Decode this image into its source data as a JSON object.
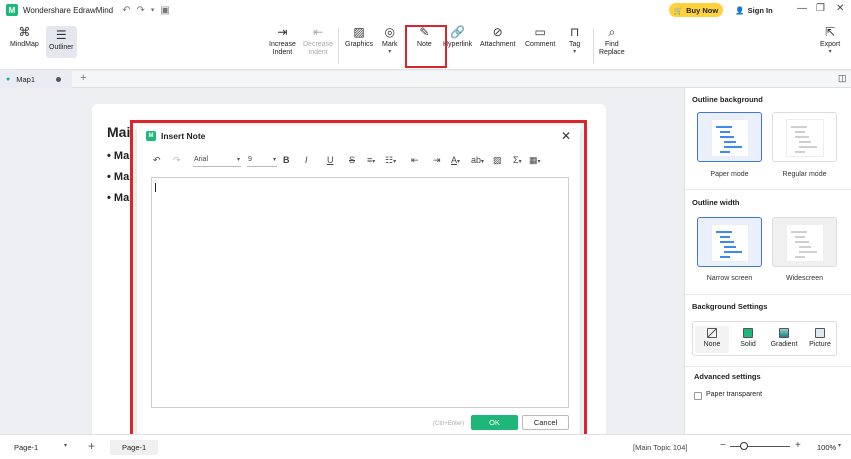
{
  "app": {
    "title": "Wondershare EdrawMind",
    "buy_now": "Buy Now",
    "sign_in": "Sign In"
  },
  "ribbon": {
    "mindmap": "MindMap",
    "outliner": "Outliner",
    "increase_indent": "Increase\nIndent",
    "decrease_indent": "Decrease\nIndent",
    "graphics": "Graphics",
    "mark": "Mark",
    "note": "Note",
    "hyperlink": "Hyperlink",
    "attachment": "Attachment",
    "comment": "Comment",
    "tag": "Tag",
    "find_replace": "Find\nReplace",
    "export": "Export"
  },
  "tabs": {
    "map": "Map1"
  },
  "doc": {
    "title": "Mai",
    "bullets": [
      "Mai",
      "Mai",
      "Mai"
    ]
  },
  "dialog": {
    "title": "Insert Note",
    "font": "Arial",
    "size": "9",
    "hint": "(Ctrl+Enter)",
    "ok": "OK",
    "cancel": "Cancel"
  },
  "panel": {
    "outline_background": "Outline background",
    "paper_mode": "Paper mode",
    "regular_mode": "Regular mode",
    "outline_width": "Outline width",
    "narrow_screen": "Narrow screen",
    "widescreen": "Widescreen",
    "background_settings": "Background Settings",
    "none": "None",
    "solid": "Solid",
    "gradient": "Gradient",
    "picture": "Picture",
    "advanced_settings": "Advanced settings",
    "paper_transparent": "Paper transparent"
  },
  "status": {
    "page_selector": "Page-1",
    "page_tab": "Page-1",
    "selection": "[Main Topic 104]",
    "zoom": "100%"
  },
  "colors": {
    "accent": "#1db77a",
    "highlight": "#d9262c",
    "selected_border": "#3d78d8",
    "buy": "#ffd23c"
  }
}
